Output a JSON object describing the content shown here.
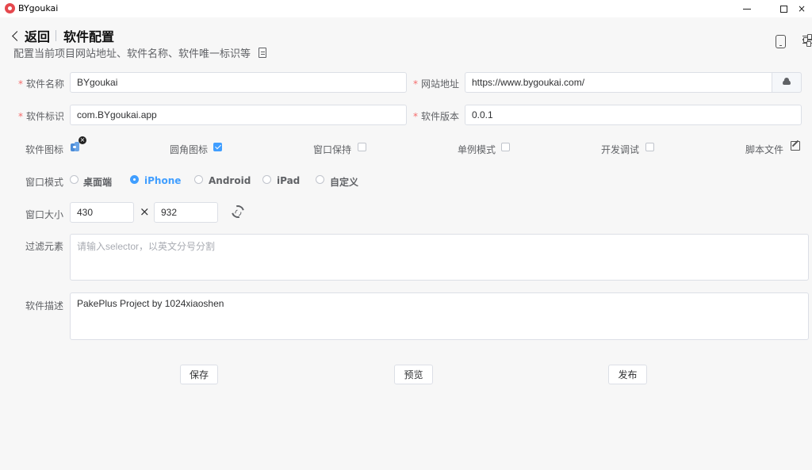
{
  "window": {
    "title": "BYgoukai",
    "close_glyph": "×"
  },
  "header": {
    "back_label": "返回",
    "title": "软件配置",
    "subtitle": "配置当前项目网站地址、软件名称、软件唯一标识等"
  },
  "form": {
    "name": {
      "label": "软件名称",
      "value": "BYgoukai"
    },
    "url": {
      "label": "网站地址",
      "value": "https://www.bygoukai.com/"
    },
    "id": {
      "label": "软件标识",
      "value": "com.BYgoukai.app"
    },
    "version": {
      "label": "软件版本",
      "value": "0.0.1"
    },
    "icon": {
      "label": "软件图标",
      "remove_glyph": "×"
    },
    "round_icon": {
      "label": "圆角图标",
      "checked": true
    },
    "keep_window": {
      "label": "窗口保持",
      "checked": false
    },
    "single_instance": {
      "label": "单例模式",
      "checked": false
    },
    "dev_debug": {
      "label": "开发调试",
      "checked": false
    },
    "script_file": {
      "label": "脚本文件"
    },
    "window_mode": {
      "label": "窗口模式",
      "options": [
        "桌面端",
        "iPhone",
        "Android",
        "iPad",
        "自定义"
      ],
      "selected": "iPhone"
    },
    "window_size": {
      "label": "窗口大小",
      "width": "430",
      "height": "932",
      "times": "×"
    },
    "filter": {
      "label": "过滤元素",
      "placeholder": "请输入selector，以英文分号分割",
      "value": ""
    },
    "description": {
      "label": "软件描述",
      "value": "PakePlus Project by 1024xiaoshen"
    }
  },
  "actions": {
    "save": "保存",
    "preview": "预览",
    "publish": "发布"
  },
  "colors": {
    "accent": "#409eff",
    "required": "#f56c6c"
  }
}
